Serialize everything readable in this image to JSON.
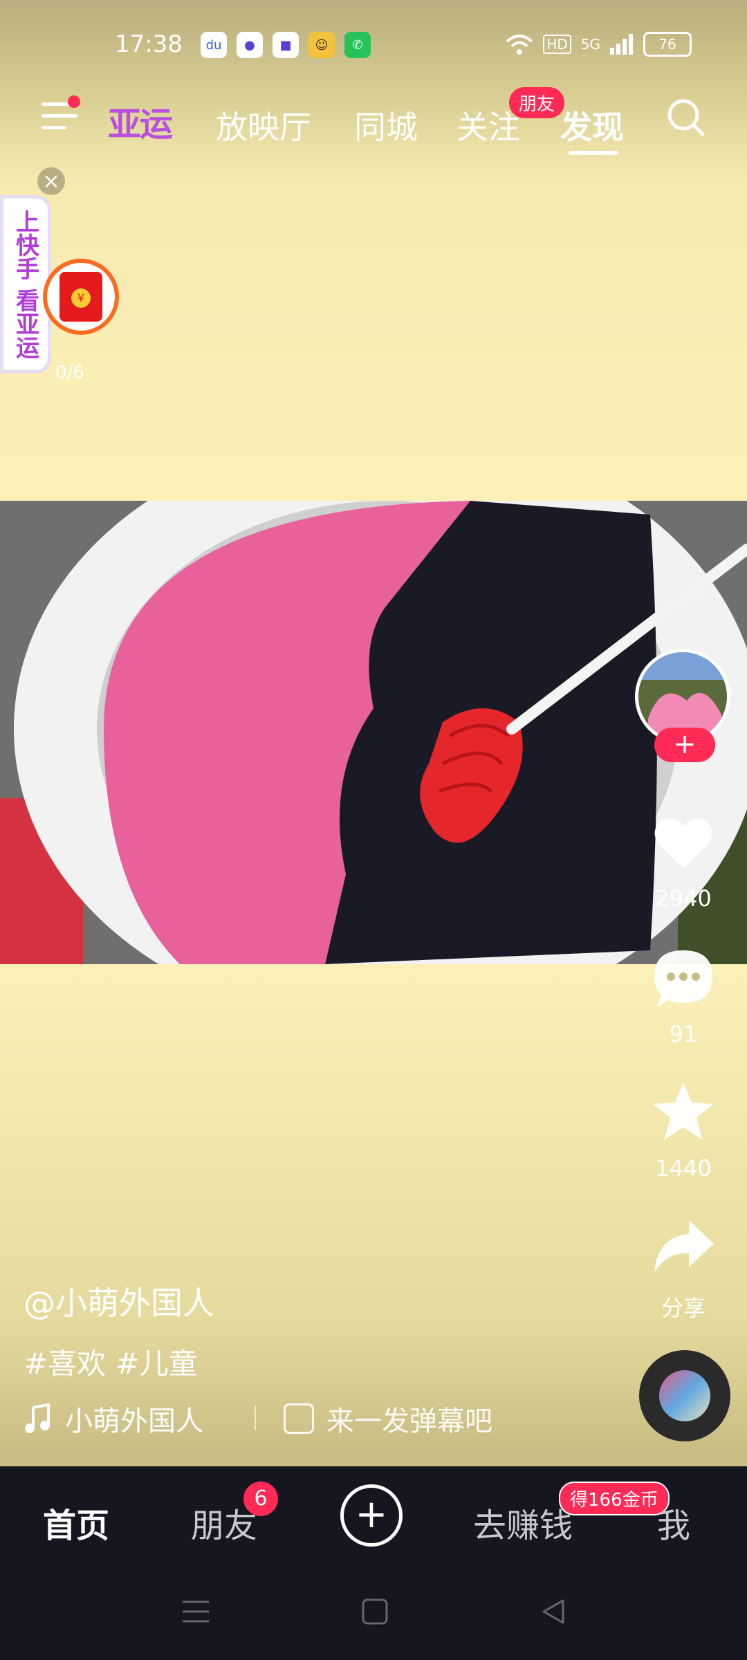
{
  "status_bar": {
    "time": "17:38",
    "network": "5G",
    "hd": "HD",
    "battery": "76"
  },
  "top_nav": {
    "logo": "亚运",
    "tabs": [
      "放映厅",
      "同城",
      "关注",
      "发现"
    ],
    "active_tab": "发现",
    "follow_badge": "朋友"
  },
  "side_widget": {
    "banner_text": "上快手 看亚运",
    "progress": "0/6"
  },
  "video": {
    "author": "@小萌外国人",
    "tags": "#喜欢 #儿童",
    "music": "小萌外国人",
    "danmu_placeholder": "来一发弹幕吧"
  },
  "actions": {
    "likes": "2940",
    "comments": "91",
    "favorites": "1440",
    "share": "分享"
  },
  "bottom_nav": {
    "home": "首页",
    "friends": "朋友",
    "friends_badge": "6",
    "earn": "去赚钱",
    "earn_badge": "得166金币",
    "me": "我"
  },
  "colors": {
    "accent": "#ff2a55",
    "background_top": "#b8ad7c",
    "background_main": "#fbf0b8",
    "nav_bg": "#161620"
  }
}
